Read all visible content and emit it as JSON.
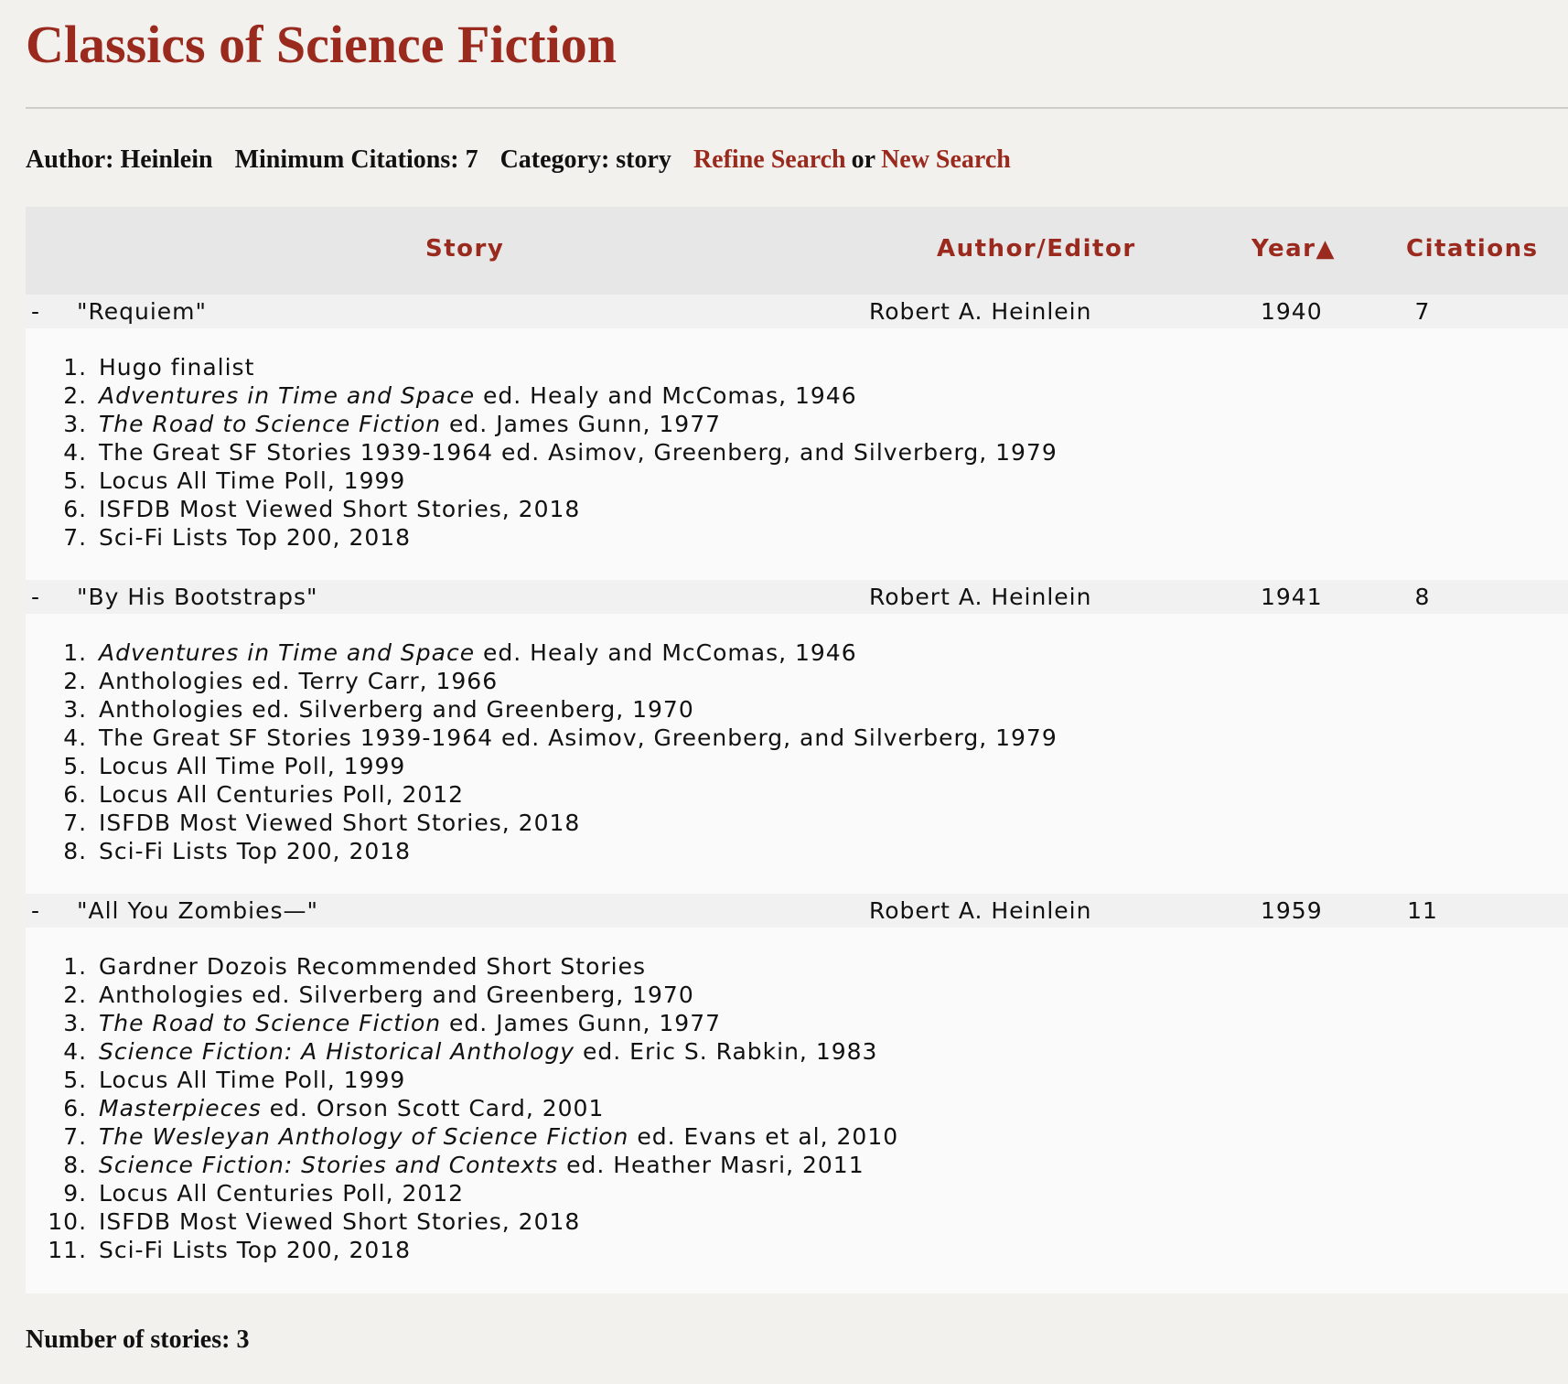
{
  "page": {
    "title": "Classics of Science Fiction"
  },
  "search": {
    "author_label": "Author: Heinlein",
    "citations_label": "Minimum Citations: 7",
    "category_label": "Category: story",
    "refine_link": "Refine Search",
    "or_text": "or",
    "new_link": "New Search"
  },
  "table": {
    "headers": {
      "story": "Story",
      "author": "Author/Editor",
      "year": "Year▲",
      "citations": "Citations"
    },
    "rows": [
      {
        "toggle": "-",
        "title": "\"Requiem\"",
        "author": "Robert A. Heinlein",
        "year": "1940",
        "citations": "7",
        "sources": [
          {
            "italic": "",
            "text": "Hugo finalist"
          },
          {
            "italic": "Adventures in Time and Space",
            "text": " ed. Healy and McComas, 1946"
          },
          {
            "italic": "The Road to Science Fiction",
            "text": " ed. James Gunn, 1977"
          },
          {
            "italic": "",
            "text": "The Great SF Stories 1939-1964 ed. Asimov, Greenberg, and Silverberg, 1979"
          },
          {
            "italic": "",
            "text": "Locus All Time Poll, 1999"
          },
          {
            "italic": "",
            "text": "ISFDB Most Viewed Short Stories, 2018"
          },
          {
            "italic": "",
            "text": "Sci-Fi Lists Top 200, 2018"
          }
        ]
      },
      {
        "toggle": "-",
        "title": "\"By His Bootstraps\"",
        "author": "Robert A. Heinlein",
        "year": "1941",
        "citations": "8",
        "sources": [
          {
            "italic": "Adventures in Time and Space",
            "text": " ed. Healy and McComas, 1946"
          },
          {
            "italic": "",
            "text": "Anthologies ed. Terry Carr, 1966"
          },
          {
            "italic": "",
            "text": "Anthologies ed. Silverberg and Greenberg, 1970"
          },
          {
            "italic": "",
            "text": "The Great SF Stories 1939-1964 ed. Asimov, Greenberg, and Silverberg, 1979"
          },
          {
            "italic": "",
            "text": "Locus All Time Poll, 1999"
          },
          {
            "italic": "",
            "text": "Locus All Centuries Poll, 2012"
          },
          {
            "italic": "",
            "text": "ISFDB Most Viewed Short Stories, 2018"
          },
          {
            "italic": "",
            "text": "Sci-Fi Lists Top 200, 2018"
          }
        ]
      },
      {
        "toggle": "-",
        "title": "\"All You Zombies—\"",
        "author": "Robert A. Heinlein",
        "year": "1959",
        "citations": "11",
        "sources": [
          {
            "italic": "",
            "text": "Gardner Dozois Recommended Short Stories"
          },
          {
            "italic": "",
            "text": "Anthologies ed. Silverberg and Greenberg, 1970"
          },
          {
            "italic": "The Road to Science Fiction",
            "text": " ed. James Gunn, 1977"
          },
          {
            "italic": "Science Fiction: A Historical Anthology",
            "text": " ed. Eric S. Rabkin, 1983"
          },
          {
            "italic": "",
            "text": "Locus All Time Poll, 1999"
          },
          {
            "italic": "Masterpieces",
            "text": " ed. Orson Scott Card, 2001"
          },
          {
            "italic": "The Wesleyan Anthology of Science Fiction",
            "text": " ed. Evans et al, 2010"
          },
          {
            "italic": "Science Fiction: Stories and Contexts",
            "text": " ed. Heather Masri, 2011"
          },
          {
            "italic": "",
            "text": "Locus All Centuries Poll, 2012"
          },
          {
            "italic": "",
            "text": "ISFDB Most Viewed Short Stories, 2018"
          },
          {
            "italic": "",
            "text": "Sci-Fi Lists Top 200, 2018"
          }
        ]
      }
    ]
  },
  "footer": {
    "count_label": "Number of stories: 3"
  },
  "colors": {
    "accent": "#9a2a1e",
    "page_background": "#f2f1ee",
    "header_background": "#e7e7e7",
    "row_background": "#f1f1f1",
    "panel_background": "#fafafa"
  }
}
